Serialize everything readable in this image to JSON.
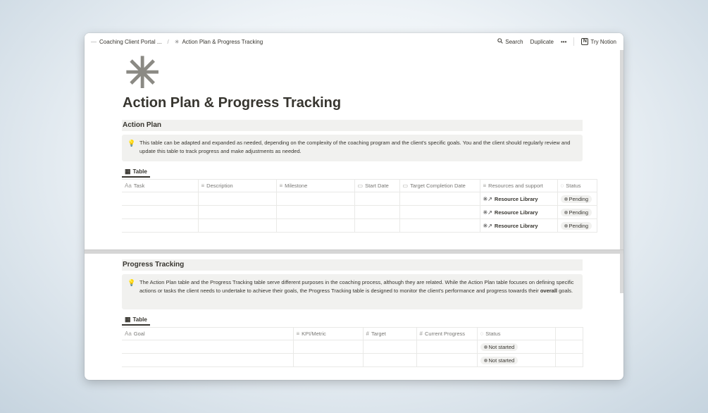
{
  "topbar": {
    "breadcrumb_parent": "Coaching Client Portal ...",
    "breadcrumb_sep": "/",
    "breadcrumb_current": "Action Plan & Progress Tracking",
    "search_label": "Search",
    "duplicate_label": "Duplicate",
    "more_label": "•••",
    "try_notion_label": "Try Notion"
  },
  "page": {
    "icon": "✳",
    "title": "Action Plan & Progress Tracking"
  },
  "action_plan": {
    "heading": "Action Plan",
    "callout_icon": "lightbulb-icon",
    "callout_text": "This table can be adapted and expanded as needed, depending on the complexity of the coaching program and the client's specific goals. You and the client should regularly review and update this table to track progress and make adjustments as needed.",
    "view_tab": "Table",
    "columns": [
      "Task",
      "Description",
      "Milestone",
      "Start Date",
      "Target Completion Date",
      "Resources and support",
      "Status"
    ],
    "column_prefixes": [
      "Aa",
      "≡",
      "≡",
      "▭",
      "▭",
      "≡",
      "◌"
    ],
    "rows": [
      {
        "resource": "Resource Library",
        "status": "Pending"
      },
      {
        "resource": "Resource Library",
        "status": "Pending"
      },
      {
        "resource": "Resource Library",
        "status": "Pending"
      }
    ]
  },
  "progress_tracking": {
    "heading": "Progress Tracking",
    "callout_icon": "lightbulb-icon",
    "callout_text_before": "The Action Plan table and the Progress Tracking table serve different purposes in the coaching process, although they are related. While the Action Plan table focuses on defining specific actions or tasks the client needs to undertake to achieve their goals, the Progress Tracking table is designed to monitor the client's performance and progress towards their ",
    "callout_text_bold": "overall",
    "callout_text_after": " goals.",
    "view_tab": "Table",
    "columns": [
      "Goal",
      "KPI/Metric",
      "Target",
      "Current Progress",
      "Status"
    ],
    "column_prefixes": [
      "Aa",
      "≡",
      "#",
      "#",
      "◌"
    ],
    "rows": [
      {
        "status": "Not started"
      },
      {
        "status": "Not started"
      }
    ]
  }
}
